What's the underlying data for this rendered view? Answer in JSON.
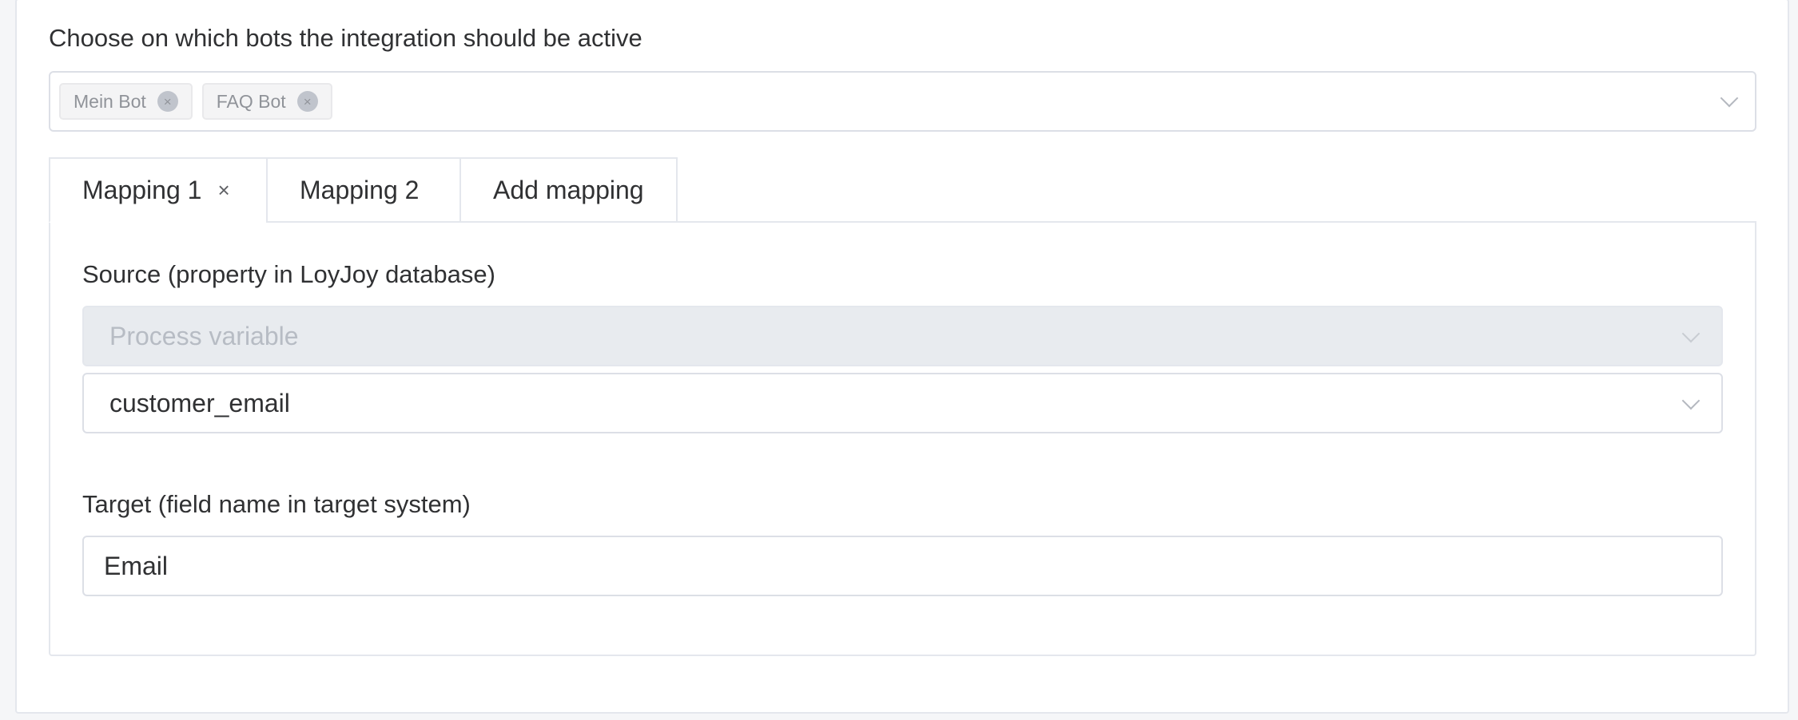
{
  "bots": {
    "label": "Choose on which bots the integration should be active",
    "selected": [
      {
        "label": "Mein Bot"
      },
      {
        "label": "FAQ Bot"
      }
    ]
  },
  "mapping_tabs": [
    {
      "label": "Mapping 1",
      "active": true,
      "closable": true
    },
    {
      "label": "Mapping 2",
      "active": false,
      "closable": false
    },
    {
      "label": "Add mapping",
      "active": false,
      "closable": false
    }
  ],
  "source": {
    "label": "Source (property in LoyJoy database)",
    "type_select": {
      "value": "Process variable",
      "disabled": true
    },
    "variable_select": {
      "value": "customer_email"
    }
  },
  "target": {
    "label": "Target (field name in target system)",
    "value": "Email"
  },
  "icons": {
    "tag_close": "close-circle-icon",
    "tab_close": "close-icon",
    "dropdown": "chevron-down-icon"
  },
  "colors": {
    "disabled_bg": "#e8ebef",
    "border": "#dcdfe6",
    "text": "#303133"
  }
}
